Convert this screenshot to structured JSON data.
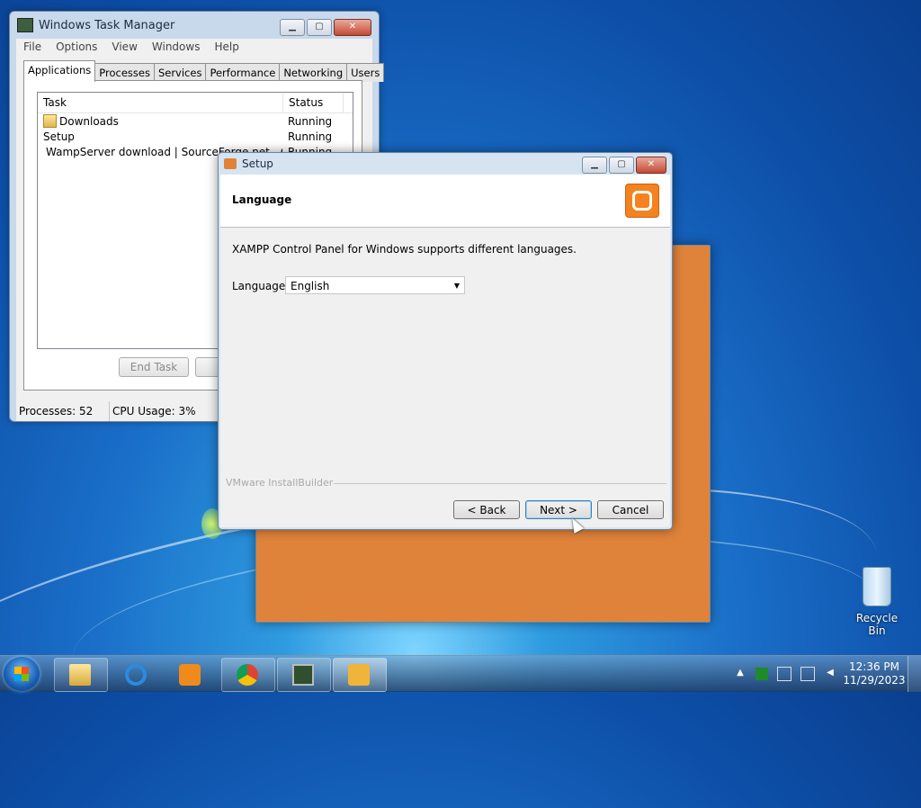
{
  "task_manager": {
    "title": "Windows Task Manager",
    "menu": [
      "File",
      "Options",
      "Windows",
      "Help"
    ],
    "tabs": [
      "Applications",
      "Processes",
      "Services",
      "Performance",
      "Networking",
      "Users"
    ],
    "active_tab": "Applications",
    "columns": {
      "task": "Task",
      "status": "Status"
    },
    "rows": [
      {
        "task": "Downloads",
        "status": "Running",
        "icon": "folder-icon"
      },
      {
        "task": "Setup",
        "status": "Running",
        "icon": "setup-icon"
      },
      {
        "task": "WampServer download | SourceForge.net - Go",
        "status": "Running",
        "icon": "chrome-icon"
      }
    ],
    "end_task_label": "End Task",
    "status_processes": "Processes: 52",
    "status_cpu": "CPU Usage: 3%"
  },
  "setup": {
    "title": "Setup",
    "header": "Language",
    "description": "XAMPP Control Panel for Windows supports different languages.",
    "language_label": "Language",
    "language_value": "English",
    "brand": "VMware InstallBuilder",
    "back_label": "< Back",
    "next_label": "Next >",
    "cancel_label": "Cancel"
  },
  "desktop": {
    "recycle_bin": "Recycle Bin"
  },
  "taskbar": {
    "apps": [
      "explorer-icon",
      "internet-explorer-icon",
      "media-player-icon",
      "chrome-icon",
      "task-manager-icon",
      "setup-icon"
    ],
    "time": "12:36 PM",
    "date": "11/29/2023"
  }
}
